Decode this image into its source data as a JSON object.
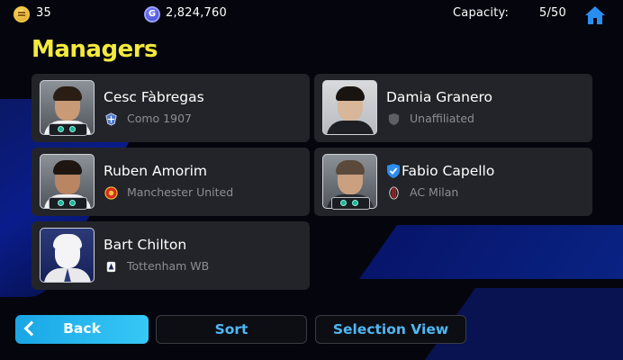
{
  "topbar": {
    "coins": "35",
    "gp": "2,824,760",
    "capacity_label": "Capacity:",
    "capacity_value": "5/50",
    "gp_icon_letter": "G"
  },
  "page_title": "Managers",
  "managers": [
    {
      "name": "Cesc Fàbregas",
      "club": "Como 1907",
      "badge_icon": "como-crest-icon"
    },
    {
      "name": "Damia Granero",
      "club": "Unaffiliated",
      "badge_icon": "shield-icon"
    },
    {
      "name": "Ruben Amorim",
      "club": "Manchester United",
      "badge_icon": "man-utd-crest-icon"
    },
    {
      "name": "Fabio Capello",
      "club": "AC Milan",
      "badge_icon": "ac-milan-crest-icon",
      "verified": true
    },
    {
      "name": "Bart Chilton",
      "club": "Tottenham WB",
      "badge_icon": "tottenham-crest-icon"
    }
  ],
  "buttons": {
    "back": "Back",
    "sort": "Sort",
    "selection_view": "Selection View"
  },
  "colors": {
    "title": "#f4ea3c",
    "accent": "#1aa6e6",
    "card": "#232429"
  }
}
